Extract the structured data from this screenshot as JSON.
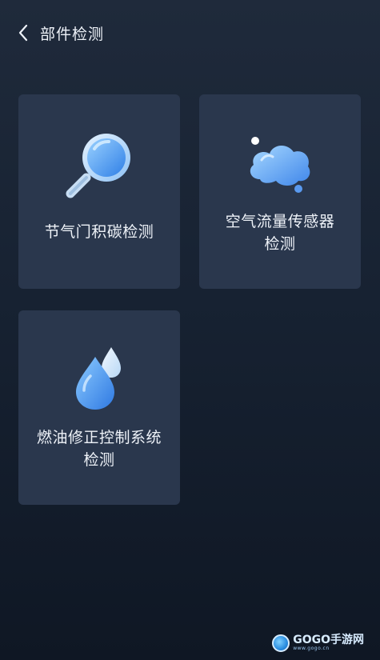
{
  "header": {
    "title": "部件检测",
    "back_icon": "chevron-left-icon"
  },
  "cards": [
    {
      "id": "throttle",
      "lines": [
        "节气门积碳检测"
      ],
      "icon": "magnifier-icon"
    },
    {
      "id": "airflow",
      "lines": [
        "空气流量传感器",
        "检测"
      ],
      "icon": "cloud-icon"
    },
    {
      "id": "fuel",
      "lines": [
        "燃油修正控制系统",
        "检测"
      ],
      "icon": "water-drop-icon"
    }
  ],
  "watermark": {
    "brand": "GOGO手游网",
    "url": "www.gogo.cn"
  },
  "colors": {
    "card_bg": "#2a374d",
    "accent_blue": "#3f8ef0",
    "text": "#eef2f8"
  }
}
